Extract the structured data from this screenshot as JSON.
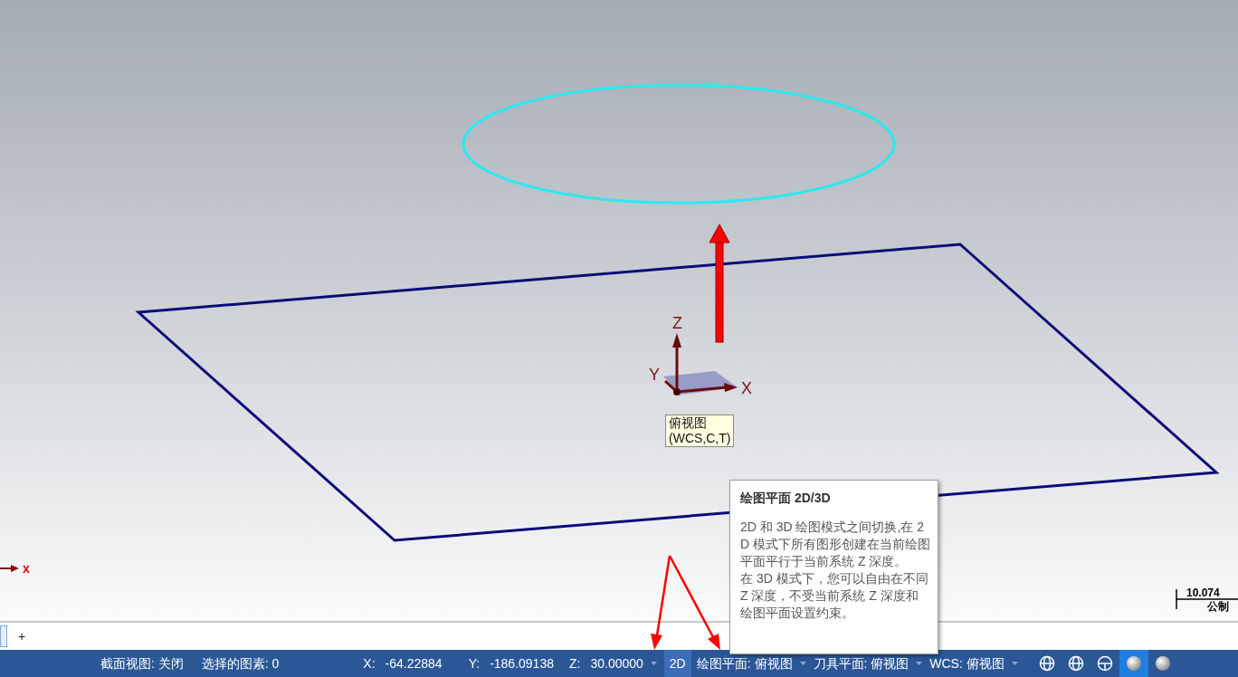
{
  "viewport": {
    "axes": {
      "x": "X",
      "y": "Y",
      "z": "Z"
    },
    "view_label": [
      "俯视图",
      "(WCS,C,T)"
    ],
    "corner_axis": "x",
    "scale": {
      "value": "10.074",
      "unit": "公制"
    }
  },
  "tooltip": {
    "title": "绘图平面 2D/3D",
    "paragraphs": [
      "2D 和 3D 绘图模式之间切换,在 2D 模式下所有图形创建在当前绘图平面平行于当前系统 Z 深度。",
      "在 3D 模式下，您可以自由在不同 Z 深度，不受当前系统 Z 深度和绘图平面设置约束。"
    ]
  },
  "tabs": {
    "add": "+"
  },
  "status_bar": {
    "section_view": "截面视图: 关闭",
    "selected_entities": "选择的图素: 0",
    "x_label": "X:",
    "x_value": "-64.22884",
    "y_label": "Y:",
    "y_value": "-186.09138",
    "z_label": "Z:",
    "z_value": "30.00000",
    "plane_mode": {
      "label": "2D",
      "selected": true
    },
    "drawing_plane": "绘图平面: 俯视图",
    "tool_plane": "刀具平面: 俯视图",
    "wcs": "WCS: 俯视图",
    "view_buttons": [
      {
        "kind": "wire",
        "selected": false
      },
      {
        "kind": "wire",
        "selected": false
      },
      {
        "kind": "half",
        "selected": false
      },
      {
        "kind": "shaded",
        "selected": true
      },
      {
        "kind": "shaded",
        "selected": false
      }
    ]
  }
}
